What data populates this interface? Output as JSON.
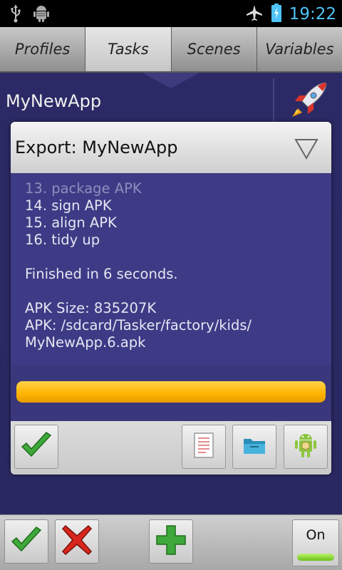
{
  "statusbar": {
    "time": "19:22",
    "icons": [
      "usb-icon",
      "android-debug-icon",
      "airplane-mode-icon",
      "battery-icon"
    ],
    "time_color": "#4fc3f7"
  },
  "tabs": [
    {
      "label": "Profiles",
      "active": false
    },
    {
      "label": "Tasks",
      "active": true
    },
    {
      "label": "Scenes",
      "active": false
    },
    {
      "label": "Variables",
      "active": false
    }
  ],
  "task": {
    "title": "MyNewApp",
    "icon": "rocket-icon"
  },
  "dialog": {
    "title": "Export: MyNewApp",
    "log": {
      "steps": [
        "13. package APK",
        "14. sign APK",
        "15. align APK",
        "16. tidy up"
      ],
      "finished": "Finished in 6 seconds.",
      "apk_size": "APK Size: 835207K",
      "apk_path_1": "APK: /sdcard/Tasker/factory/kids/",
      "apk_path_2": "MyNewApp.6.apk"
    },
    "progress": 1.0,
    "progress_color": "#ffb300",
    "buttons": [
      "confirm-check-icon",
      "document-icon",
      "folder-icon",
      "android-package-icon"
    ]
  },
  "bottombar": {
    "buttons": [
      "accept-check-icon",
      "cancel-x-icon",
      "add-plus-icon"
    ],
    "toggle_label": "On",
    "toggle_on": true
  }
}
